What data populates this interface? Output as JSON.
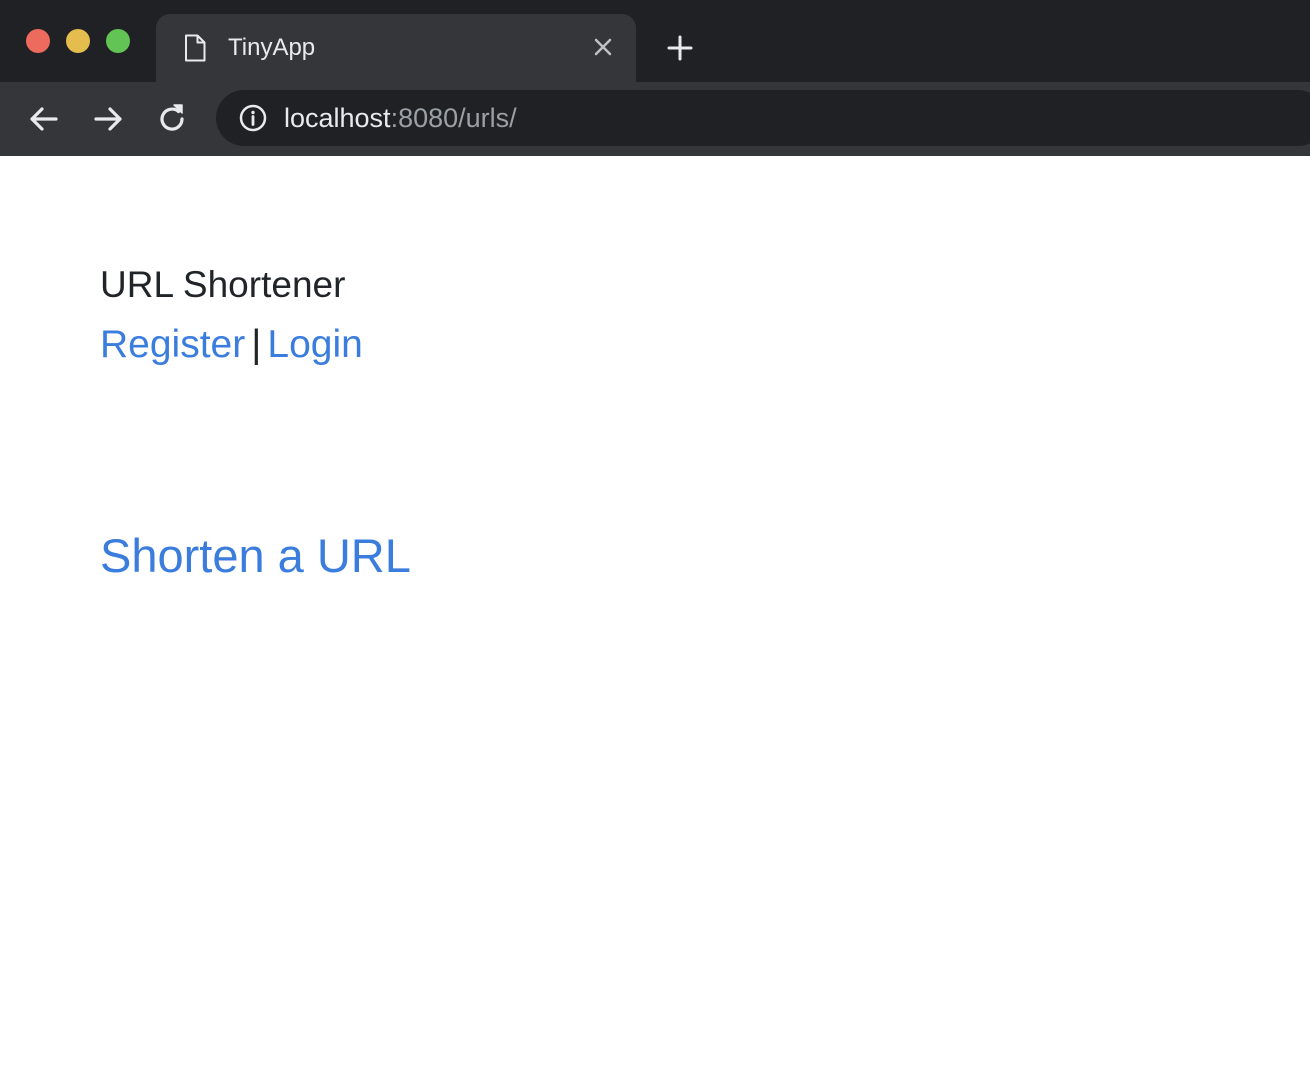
{
  "browser": {
    "tab": {
      "title": "TinyApp",
      "icon": "document-icon"
    },
    "address": {
      "host": "localhost",
      "rest": ":8080/urls/"
    },
    "colors": {
      "traffic_close": "#ed6a5e",
      "traffic_minimize": "#e4bd4e",
      "traffic_maximize": "#62c454"
    }
  },
  "header": {
    "brand": "URL Shortener",
    "register_label": "Register",
    "separator": "|",
    "login_label": "Login"
  },
  "main": {
    "shorten_link": "Shorten a URL"
  },
  "colors": {
    "link": "#3b7ddd",
    "text": "#212529"
  }
}
